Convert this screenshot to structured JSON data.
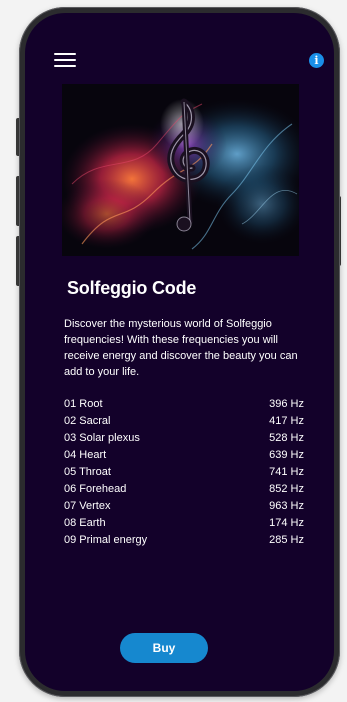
{
  "app": {
    "title": "Solfeggio Code",
    "description": "Discover the mysterious world of Solfeggio frequencies! With these frequencies you will receive energy and discover the beauty you can add to your life."
  },
  "header": {
    "menu_icon": "hamburger-menu-icon",
    "info_icon": "info-icon",
    "info_glyph": "i"
  },
  "hero": {
    "image": "treble clef in colored smoke"
  },
  "frequencies": [
    {
      "name": "01 Root",
      "value": "396 Hz"
    },
    {
      "name": "02 Sacral",
      "value": "417 Hz"
    },
    {
      "name": "03 Solar plexus",
      "value": "528 Hz"
    },
    {
      "name": "04 Heart",
      "value": "639 Hz"
    },
    {
      "name": "05 Throat",
      "value": "741 Hz"
    },
    {
      "name": "06 Forehead",
      "value": "852 Hz"
    },
    {
      "name": "07 Vertex",
      "value": "963 Hz"
    },
    {
      "name": "08 Earth",
      "value": "174 Hz"
    },
    {
      "name": "09 Primal energy",
      "value": "285 Hz"
    }
  ],
  "buy_button": {
    "label": "Buy"
  },
  "colors": {
    "background": "#13012a",
    "accent": "#1688cf",
    "info": "#1a8fe8",
    "text": "#ffffff"
  }
}
